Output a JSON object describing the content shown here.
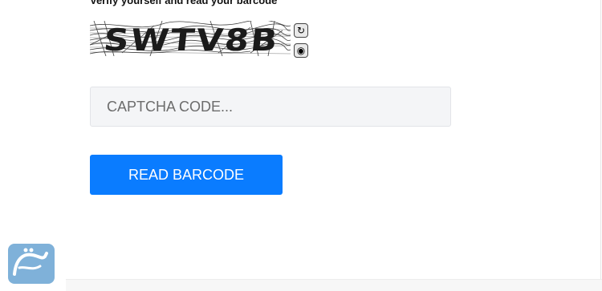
{
  "form": {
    "heading": "Verify yourself and read your barcode",
    "captcha_image_text": "SWTV8B",
    "refresh_icon": "refresh-icon",
    "audio_icon": "audio-icon",
    "captcha_placeholder": "CAPTCHA CODE...",
    "submit_label": "READ BARCODE"
  },
  "colors": {
    "primary_button": "#0a7cff",
    "input_background": "#f4f5f7",
    "logo_background": "#7fb1d9"
  }
}
